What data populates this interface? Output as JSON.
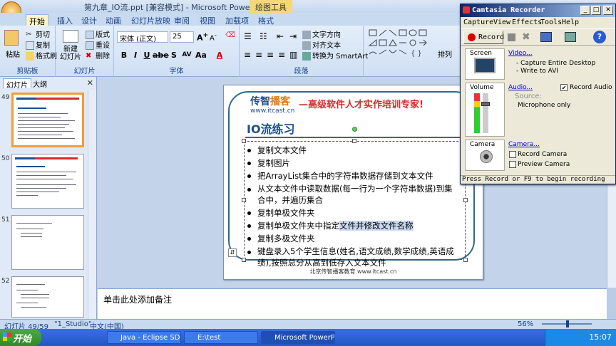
{
  "window": {
    "title": "第九章_IO流.ppt [兼容模式] - Microsoft PowerPoint",
    "context_tab": "绘图工具"
  },
  "ribbon_tabs": [
    "开始",
    "插入",
    "设计",
    "动画",
    "幻灯片放映",
    "审阅",
    "视图",
    "加载项",
    "格式"
  ],
  "ribbon": {
    "clipboard": {
      "label": "剪贴板",
      "paste": "粘贴",
      "cut": "剪切",
      "copy": "复制",
      "format_painter": "格式刷"
    },
    "slides": {
      "label": "幻灯片",
      "new_slide": "新建\n幻灯片",
      "layout": "版式",
      "reset": "重设",
      "delete": "删除"
    },
    "font": {
      "label": "字体",
      "name": "宋体 (正文)",
      "size": "25"
    },
    "paragraph": {
      "label": "段落",
      "text_direction": "文字方向",
      "align_text": "对齐文本",
      "smartart": "转换为 SmartArt"
    },
    "drawing": {
      "arrange": "排列"
    }
  },
  "left_panel": {
    "tab_slides": "幻灯片",
    "tab_outline": "大纲",
    "slide_numbers": [
      "49",
      "50",
      "51",
      "52"
    ]
  },
  "slide": {
    "logo_main": "传智",
    "logo_accent": "播客",
    "logo_url": "www.itcast.cn",
    "slogan": "—高级软件人才实作培训专家!",
    "title": "IO流练习",
    "bullets": [
      "复制文本文件",
      "复制图片",
      "把ArrayList集合中的字符串数据存储到文本文件",
      "从文本文件中读取数据(每一行为一个字符串数据)到集合中，并遍历集合",
      "复制单极文件夹",
      "复制单极文件夹中指定文件并修改文件名称",
      "复制多极文件夹",
      "键盘录入5个学生信息(姓名,语文成绩,数学成绩,英语成绩),按照总分从高到低存入文本文件"
    ],
    "footer": "北京传智播客教育 www.itcast.cn"
  },
  "notes": {
    "placeholder": "单击此处添加备注"
  },
  "status_bar": {
    "slide_pos": "幻灯片 49/59",
    "theme": "\"1_Studio\"",
    "language": "中文(中国)",
    "zoom": "56%"
  },
  "taskbar": {
    "start": "开始",
    "items": [
      "Java - Eclipse SDK",
      "E:\\test",
      "Microsoft PowerP..."
    ],
    "clock": "15:07"
  },
  "camtasia": {
    "title": "Camtasia Recorder",
    "menu": [
      "Capture",
      "View",
      "Effects",
      "Tools",
      "Help"
    ],
    "record_label": "Record",
    "screen": {
      "label": "Screen",
      "link": "Video...",
      "line1": "- Capture Entire Desktop",
      "line2": "- Write to AVI"
    },
    "audio": {
      "label": "Volume",
      "link": "Audio...",
      "record_audio": "Record Audio",
      "source_label": "Source:",
      "source": "Microphone only"
    },
    "camera": {
      "label": "Camera",
      "link": "Camera...",
      "record_camera": "Record Camera",
      "preview_camera": "Preview Camera"
    },
    "status": "Press Record or F9 to begin recording"
  }
}
